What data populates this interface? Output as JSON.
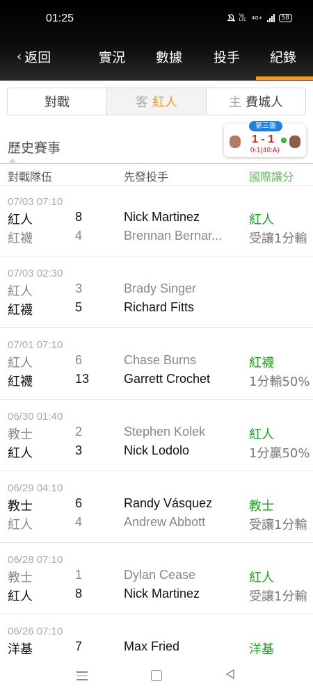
{
  "status": {
    "time": "01:25",
    "network_label": "4G+",
    "volte": "Vo LTE",
    "battery": "58"
  },
  "nav": {
    "back_label": "返回",
    "tabs": [
      {
        "label": "實況",
        "active": false
      },
      {
        "label": "數據",
        "active": false
      },
      {
        "label": "投手",
        "active": false
      },
      {
        "label": "紀錄",
        "active": true
      }
    ],
    "accent": "#f39a1b"
  },
  "segment": {
    "items": [
      {
        "label": "對戰",
        "prefix": "",
        "highlight": false
      },
      {
        "prefix": "客",
        "label": "紅人",
        "highlight": true
      },
      {
        "prefix": "主",
        "label": "費城人",
        "highlight": false
      }
    ]
  },
  "section_title": "歷史賽事",
  "live_card": {
    "inning": "第三盤",
    "score": "1 - 1",
    "count": "0-1(40:A)"
  },
  "columns": {
    "teams": "對戰隊伍",
    "pitchers": "先發投手",
    "handicap": "國際讓分"
  },
  "games": [
    {
      "date": "07/03 07:10",
      "rows": [
        {
          "team": "紅人",
          "runs": "8",
          "pitcher": "Nick Martinez",
          "handicap": "紅人",
          "win": true
        },
        {
          "team": "紅襪",
          "runs": "4",
          "pitcher": "Brennan Bernar...",
          "handicap": "受讓1分輸",
          "win": false
        }
      ]
    },
    {
      "date": "07/03 02:30",
      "rows": [
        {
          "team": "紅人",
          "runs": "3",
          "pitcher": "Brady Singer",
          "handicap": "",
          "win": false
        },
        {
          "team": "紅襪",
          "runs": "5",
          "pitcher": "Richard Fitts",
          "handicap": "",
          "win": true
        }
      ]
    },
    {
      "date": "07/01 07:10",
      "rows": [
        {
          "team": "紅人",
          "runs": "6",
          "pitcher": "Chase Burns",
          "handicap": "紅襪",
          "win": false
        },
        {
          "team": "紅襪",
          "runs": "13",
          "pitcher": "Garrett Crochet",
          "handicap": "1分輸50%",
          "win": true
        }
      ]
    },
    {
      "date": "06/30 01:40",
      "rows": [
        {
          "team": "教士",
          "runs": "2",
          "pitcher": "Stephen Kolek",
          "handicap": "紅人",
          "win": false
        },
        {
          "team": "紅人",
          "runs": "3",
          "pitcher": "Nick Lodolo",
          "handicap": "1分贏50%",
          "win": true
        }
      ]
    },
    {
      "date": "06/29 04:10",
      "rows": [
        {
          "team": "教士",
          "runs": "6",
          "pitcher": "Randy Vásquez",
          "handicap": "教士",
          "win": true
        },
        {
          "team": "紅人",
          "runs": "4",
          "pitcher": "Andrew Abbott",
          "handicap": "受讓1分輸",
          "win": false
        }
      ]
    },
    {
      "date": "06/28 07:10",
      "rows": [
        {
          "team": "教士",
          "runs": "1",
          "pitcher": "Dylan Cease",
          "handicap": "紅人",
          "win": false
        },
        {
          "team": "紅人",
          "runs": "8",
          "pitcher": "Nick Martinez",
          "handicap": "受讓1分輸",
          "win": true
        }
      ]
    },
    {
      "date": "06/26 07:10",
      "rows": [
        {
          "team": "洋基",
          "runs": "7",
          "pitcher": "Max Fried",
          "handicap": "洋基",
          "win": true
        },
        {
          "team": "",
          "runs": "",
          "pitcher": "",
          "handicap": "",
          "win": false
        }
      ]
    }
  ],
  "icons": [
    "mute-bell-icon",
    "signal-icon",
    "battery-icon",
    "menu-icon",
    "home-icon",
    "back-triangle-icon"
  ]
}
